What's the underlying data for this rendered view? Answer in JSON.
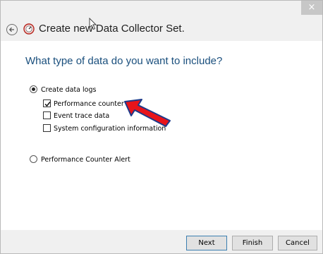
{
  "window": {
    "title": "Create new Data Collector Set.",
    "close_glyph": "×"
  },
  "page": {
    "question": "What type of data do you want to include?"
  },
  "options": {
    "create_data_logs": {
      "label": "Create data logs",
      "selected": true
    },
    "performance_counter": {
      "label": "Performance counter",
      "checked": true
    },
    "event_trace_data": {
      "label": "Event trace data",
      "checked": false
    },
    "system_configuration": {
      "label": "System configuration information",
      "checked": false
    },
    "performance_counter_alert": {
      "label": "Performance Counter Alert",
      "selected": false
    }
  },
  "buttons": {
    "next": "Next",
    "finish": "Finish",
    "cancel": "Cancel"
  },
  "colors": {
    "question_text": "#1a4f7d",
    "annotation_arrow": "#e8141a",
    "header_bg": "#f0f0f0"
  },
  "icons": {
    "back": "back-arrow-icon",
    "app": "data-collector-icon",
    "annotation": "red-arrow-annotation"
  }
}
